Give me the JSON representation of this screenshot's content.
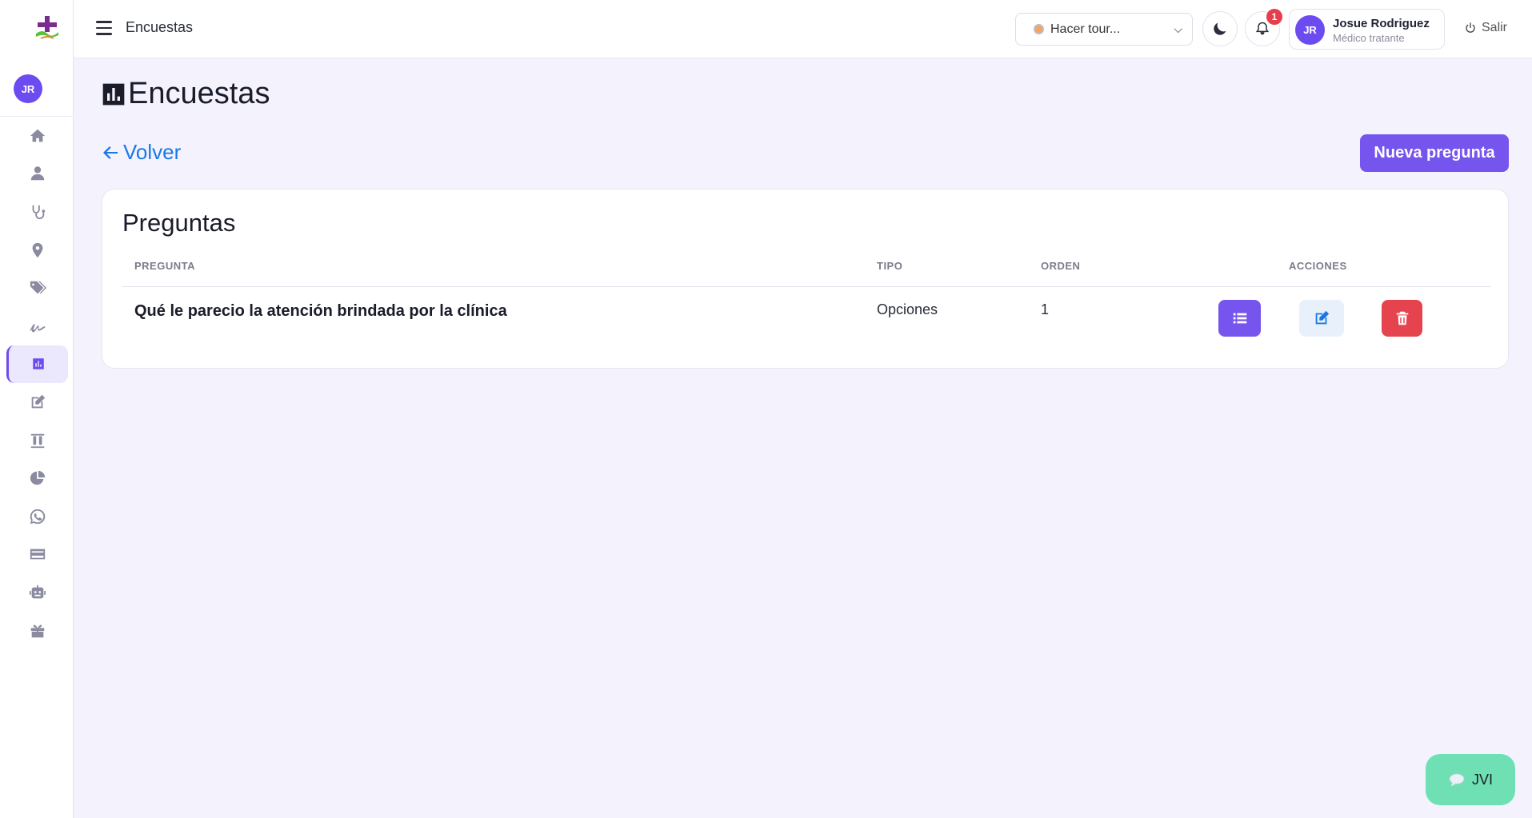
{
  "sidebar": {
    "avatar_initials": "JR",
    "items": [
      {
        "icon": "home-icon"
      },
      {
        "icon": "user-icon"
      },
      {
        "icon": "stethoscope-icon"
      },
      {
        "icon": "location-pin-icon"
      },
      {
        "icon": "tags-icon"
      },
      {
        "icon": "signature-icon"
      },
      {
        "icon": "poll-chart-icon",
        "active": true
      },
      {
        "icon": "edit-square-icon"
      },
      {
        "icon": "test-tubes-icon"
      },
      {
        "icon": "pie-chart-icon"
      },
      {
        "icon": "whatsapp-icon"
      },
      {
        "icon": "credit-card-icon"
      },
      {
        "icon": "robot-icon"
      },
      {
        "icon": "gift-icon"
      }
    ]
  },
  "topbar": {
    "title": "Encuestas",
    "tour_select": "Hacer tour...",
    "notification_count": "1",
    "user_initials": "JR",
    "user_name": "Josue Rodriguez",
    "user_role": "Médico tratante",
    "logout_label": "Salir"
  },
  "main": {
    "title": "Encuestas",
    "back_label": "Volver",
    "new_button": "Nueva pregunta",
    "card_title": "Preguntas",
    "columns": [
      "PREGUNTA",
      "TIPO",
      "ORDEN",
      "ACCIONES"
    ],
    "rows": [
      {
        "pregunta": "Qué le parecio la atención brindada por la clínica",
        "tipo": "Opciones",
        "orden": "1"
      }
    ]
  },
  "chat_widget": {
    "label": "JVI"
  },
  "colors": {
    "accent": "#7654ee",
    "danger": "#e5434d",
    "link": "#1a78e6",
    "chat": "#6fe0b3"
  }
}
